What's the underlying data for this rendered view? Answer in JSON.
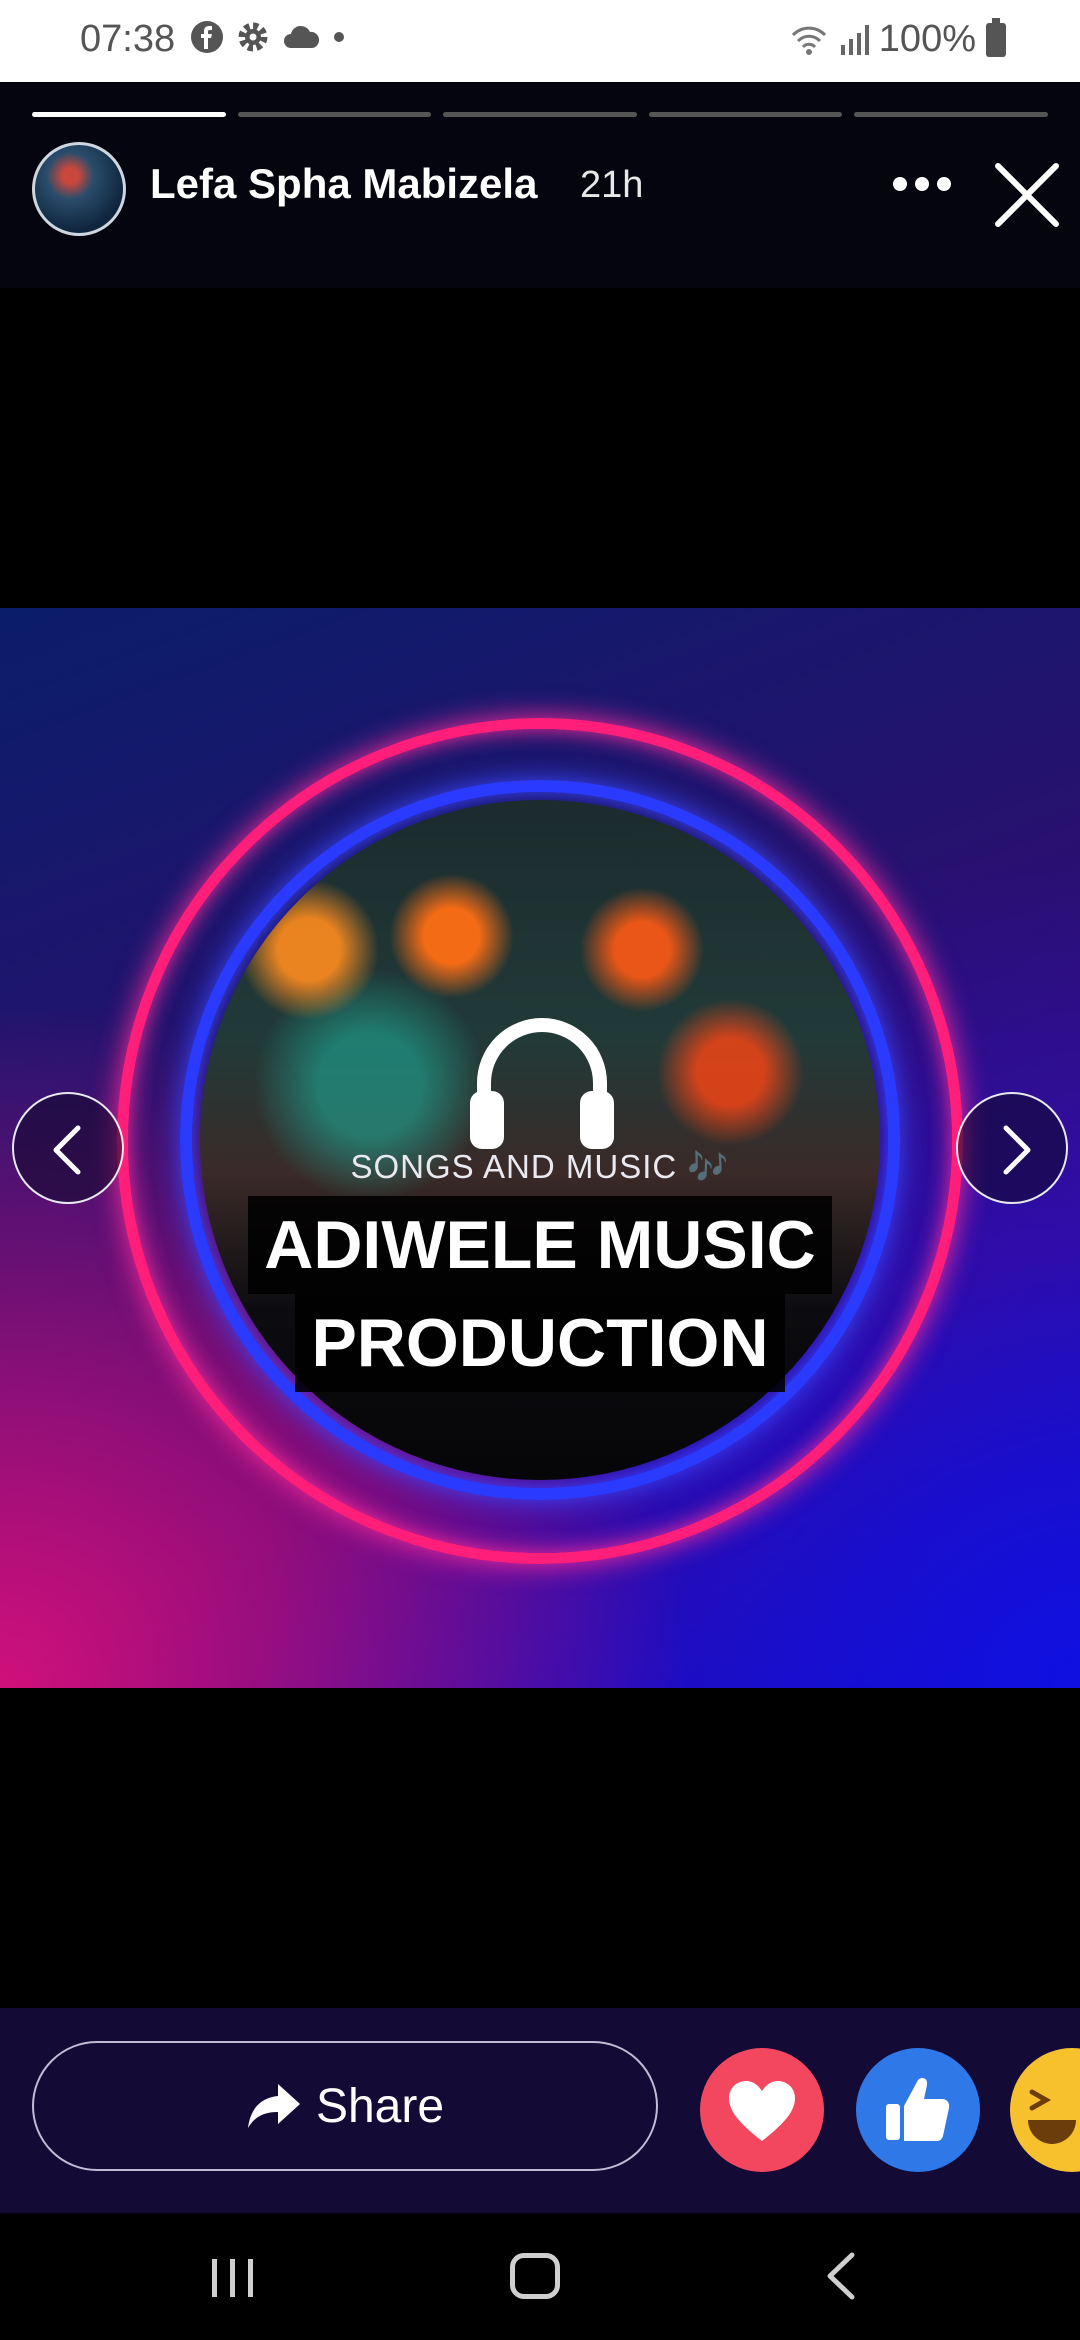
{
  "status_bar": {
    "time": "07:38",
    "left_icons": [
      "facebook-icon",
      "settings-icon",
      "cloud-icon",
      "dot-icon"
    ],
    "battery": "100%",
    "right_icons": [
      "wifi-icon",
      "signal-icon",
      "battery-icon"
    ]
  },
  "story": {
    "author": "Lefa Spha Mabizela",
    "time_ago": "21h",
    "progress": [
      1,
      0,
      0,
      0,
      0
    ],
    "image": {
      "tagline": "SONGS AND MUSIC",
      "tagline_note": "🎶",
      "title_line1": "ADIWELE MUSIC",
      "title_line2": "PRODUCTION"
    }
  },
  "actions": {
    "share_label": "Share",
    "reactions": [
      "love-reaction",
      "like-reaction",
      "haha-reaction"
    ]
  },
  "colors": {
    "action_bar_bg": "#140a36",
    "love": "#f2475f",
    "like": "#2f78e8",
    "haha": "#f7c12e"
  }
}
